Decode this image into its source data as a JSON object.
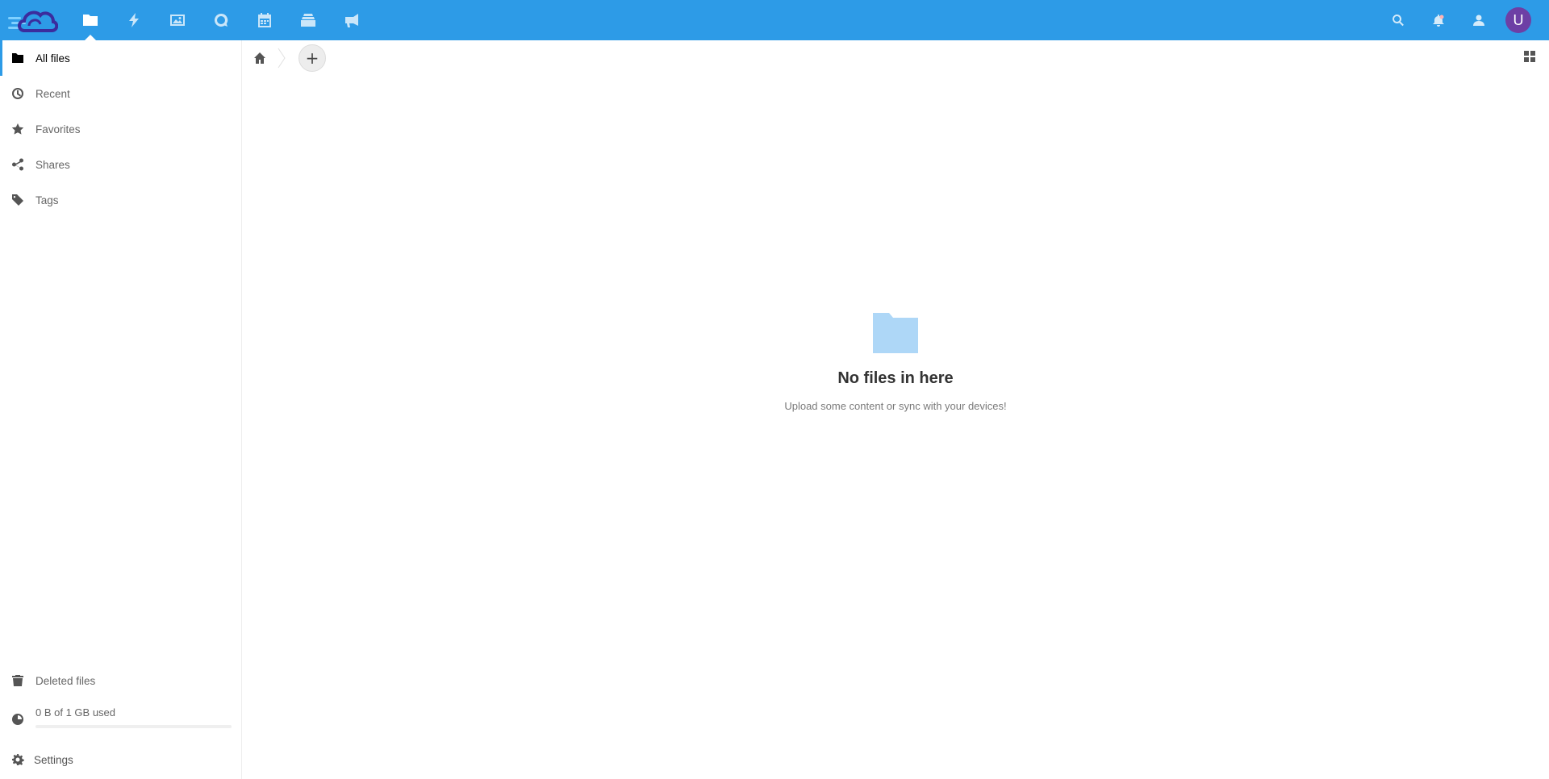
{
  "header": {
    "brand_color": "#2d9be7",
    "apps": [
      {
        "name": "files",
        "icon": "folder-icon",
        "active": true
      },
      {
        "name": "activity",
        "icon": "lightning-icon",
        "active": false
      },
      {
        "name": "photos",
        "icon": "image-icon",
        "active": false
      },
      {
        "name": "talk",
        "icon": "chat-bubble-icon",
        "active": false
      },
      {
        "name": "calendar",
        "icon": "calendar-icon",
        "active": false
      },
      {
        "name": "deck",
        "icon": "stack-icon",
        "active": false
      },
      {
        "name": "announcements",
        "icon": "megaphone-icon",
        "active": false
      }
    ],
    "right_icons": [
      "search-icon",
      "notifications-bell-icon",
      "contacts-icon"
    ],
    "avatar_initial": "U",
    "avatar_color": "#6d3fa5"
  },
  "sidebar": {
    "items": [
      {
        "label": "All files",
        "icon": "folder-icon",
        "active": true
      },
      {
        "label": "Recent",
        "icon": "clock-icon",
        "active": false
      },
      {
        "label": "Favorites",
        "icon": "star-icon",
        "active": false
      },
      {
        "label": "Shares",
        "icon": "share-icon",
        "active": false
      },
      {
        "label": "Tags",
        "icon": "tag-icon",
        "active": false
      }
    ],
    "deleted_files_label": "Deleted files",
    "quota_text": "0 B of 1 GB used",
    "quota_fraction": 0,
    "settings_label": "Settings"
  },
  "main": {
    "breadcrumb_home_icon": "home-icon",
    "add_button_label": "+",
    "view_toggle_icon": "grid-view-icon",
    "empty_title": "No files in here",
    "empty_subtitle": "Upload some content or sync with your devices!",
    "empty_folder_color": "#aed7f7"
  }
}
